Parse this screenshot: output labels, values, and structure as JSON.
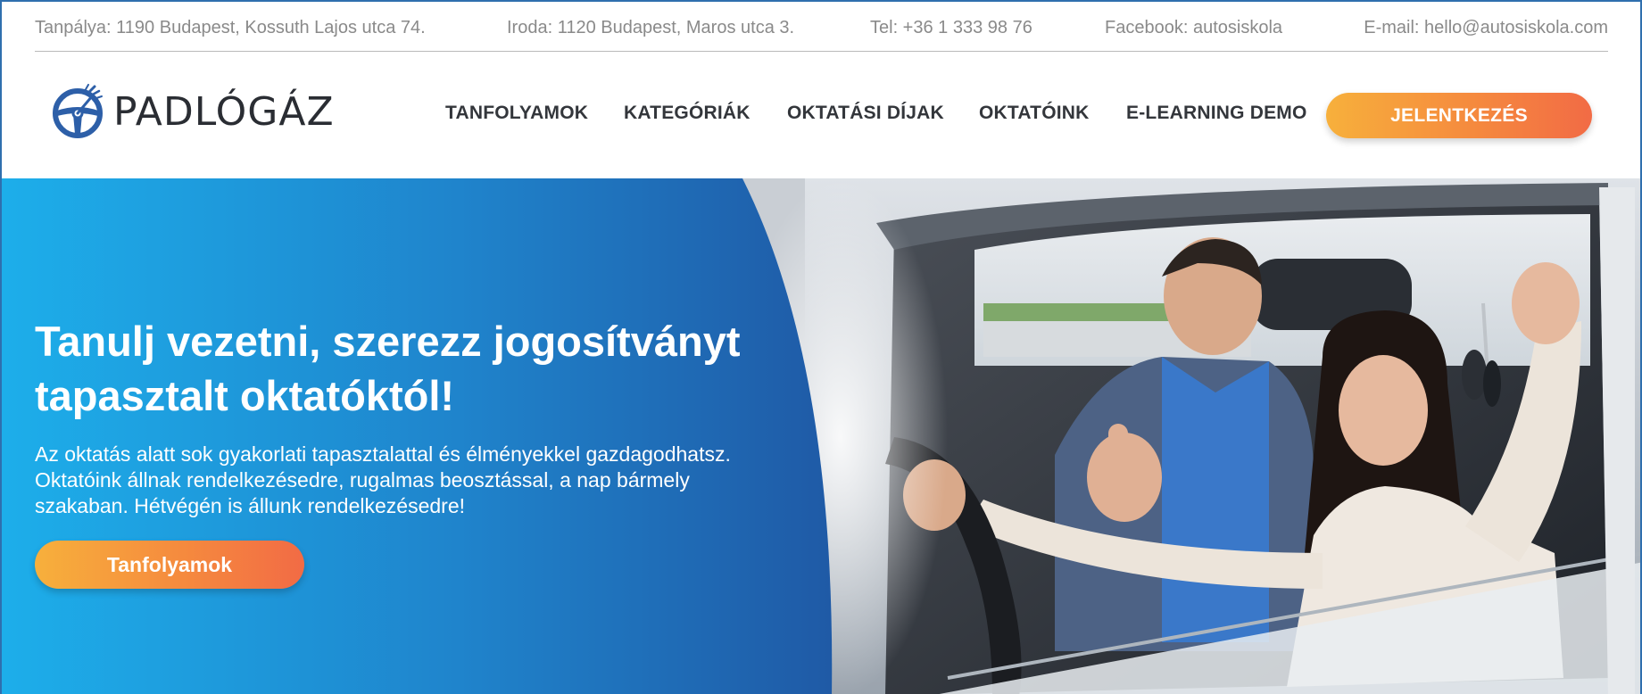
{
  "topbar": {
    "tanpalya": "Tanpálya: 1190 Budapest, Kossuth Lajos utca 74.",
    "iroda": "Iroda: 1120 Budapest, Maros utca 3.",
    "tel": "Tel: +36 1 333 98 76",
    "facebook": "Facebook: autosiskola",
    "email": "E-mail: hello@autosiskola.com"
  },
  "logo": {
    "text": "PADLÓGÁZ",
    "icon": "steering-wheel-speedometer-icon"
  },
  "nav": {
    "items": [
      {
        "label": "TANFOLYAMOK"
      },
      {
        "label": "KATEGÓRIÁK"
      },
      {
        "label": "OKTATÁSI DÍJAK"
      },
      {
        "label": "OKTATÓINK"
      },
      {
        "label": "E-LEARNING DEMO"
      }
    ],
    "cta": "JELENTKEZÉS"
  },
  "hero": {
    "title_line1": "Tanulj vezetni, szerezz jogosítványt",
    "title_line2": "tapasztalt oktatóktól!",
    "text_line1": "Az oktatás alatt sok gyakorlati tapasztalattal és élményekkel gazdagodhatsz.",
    "text_line2": "Oktatóink állnak rendelkezésedre, rugalmas beosztással, a nap bármely",
    "text_line3": "szakaban. Hétvégén is állunk rendelkezésedre!",
    "button": "Tanfolyamok",
    "image": "smiling-driver-and-instructor-in-car-photo"
  },
  "colors": {
    "blue_start": "#1daeea",
    "blue_end": "#1f5aa6",
    "orange_start": "#f7b03c",
    "orange_end": "#f26b45",
    "logo_blue": "#2d5fa8",
    "nav_text": "#33363b",
    "topbar_text": "#8a8a8a"
  }
}
